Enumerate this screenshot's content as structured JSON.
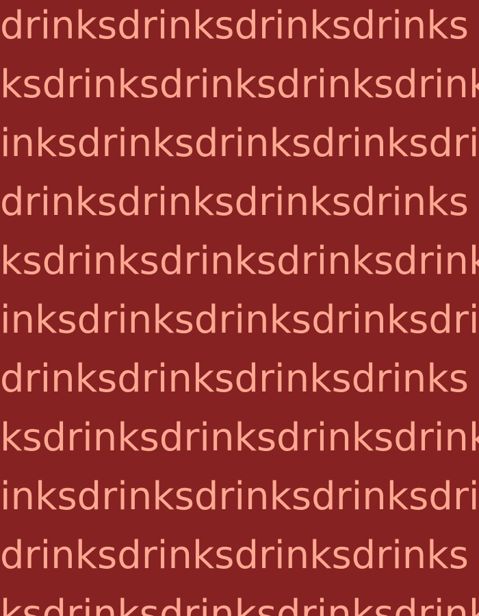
{
  "pattern": {
    "background_color": "#862222",
    "text_color": "#FFA791",
    "rows": [
      "drinksdrinksdrinksdrinks",
      "ksdrinksdrinksdrinksdrinks",
      "inksdrinksdrinksdrinksdrinks",
      "drinksdrinksdrinksdrinks",
      "ksdrinksdrinksdrinksdrinks",
      "inksdrinksdrinksdrinksdrinks",
      "drinksdrinksdrinksdrinks",
      "ksdrinksdrinksdrinksdrinks",
      "inksdrinksdrinksdrinksdrinks",
      "drinksdrinksdrinksdrinks",
      "ksdrinksdrinksdrinksdrinks"
    ]
  }
}
